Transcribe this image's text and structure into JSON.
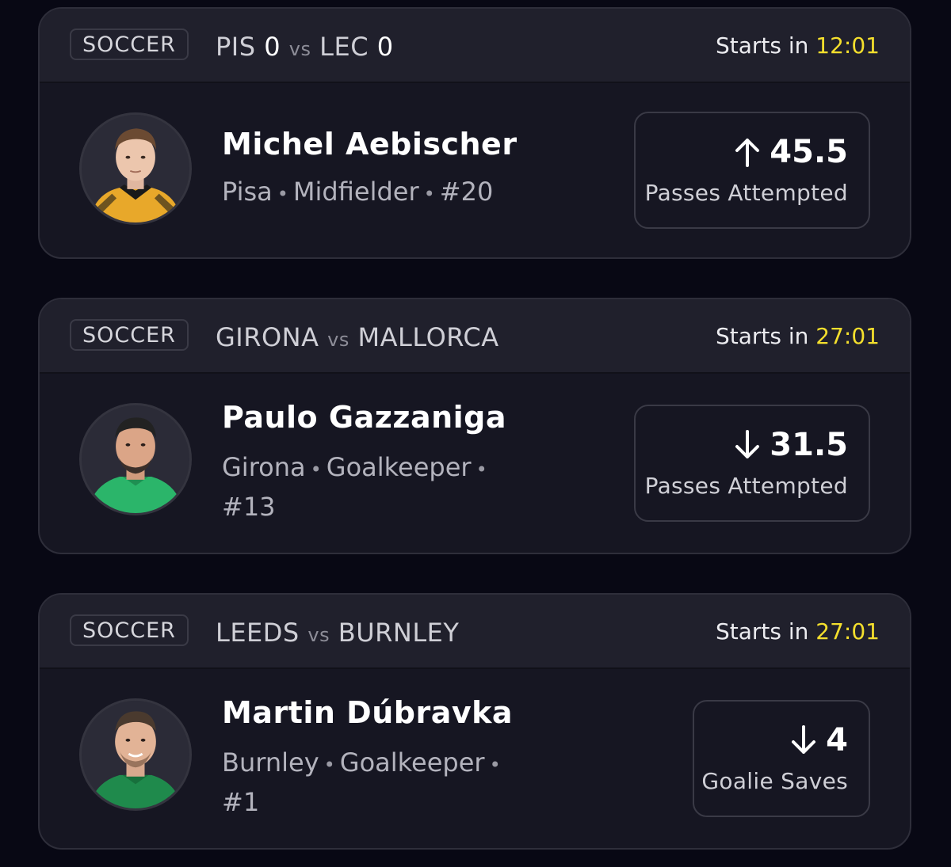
{
  "cards": [
    {
      "sport": "SOCCER",
      "home": "PIS",
      "home_score": "0",
      "vs": "vs",
      "away": "LEC",
      "away_score": "0",
      "starts_label": "Starts in",
      "countdown": "12:01",
      "player": {
        "name": "Michel Aebischer",
        "team": "Pisa",
        "position": "Midfielder",
        "number": "#20"
      },
      "pick": {
        "direction": "up",
        "arrow_icon": "arrow-up-icon",
        "value": "45.5",
        "stat": "Passes Attempted"
      }
    },
    {
      "sport": "SOCCER",
      "home": "GIRONA",
      "vs": "vs",
      "away": "MALLORCA",
      "starts_label": "Starts in",
      "countdown": "27:01",
      "player": {
        "name": "Paulo Gazzaniga",
        "team": "Girona",
        "position": "Goalkeeper",
        "number": "#13"
      },
      "pick": {
        "direction": "down",
        "arrow_icon": "arrow-down-icon",
        "value": "31.5",
        "stat": "Passes Attempted"
      }
    },
    {
      "sport": "SOCCER",
      "home": "LEEDS",
      "vs": "vs",
      "away": "BURNLEY",
      "starts_label": "Starts in",
      "countdown": "27:01",
      "player": {
        "name": "Martin Dúbravka",
        "team": "Burnley",
        "position": "Goalkeeper",
        "number": "#1"
      },
      "pick": {
        "direction": "down",
        "arrow_icon": "arrow-down-icon",
        "value": "4",
        "stat": "Goalie Saves"
      }
    }
  ],
  "colors": {
    "background": "#080814",
    "card": "#161622",
    "header": "#20202c",
    "countdown": "#f4df2d"
  }
}
